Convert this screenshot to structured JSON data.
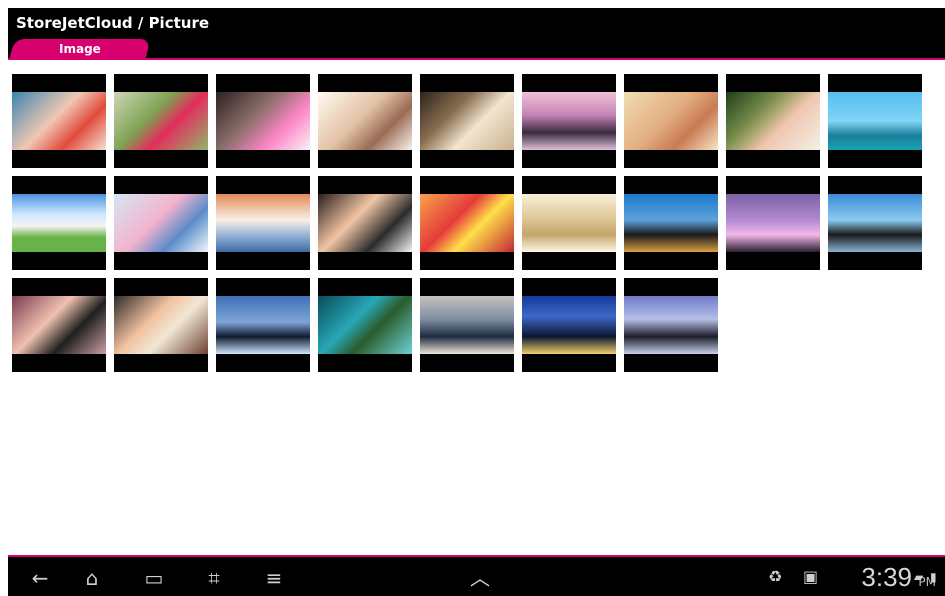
{
  "app": {
    "title": "StoreJetCloud / Picture",
    "tab_label": "Image",
    "accent_color": "#d8006f"
  },
  "gallery": {
    "rows": [
      {
        "items": [
          {
            "name": "kid-face-paint-thumbnail"
          },
          {
            "name": "pink-flower-thumbnail"
          },
          {
            "name": "couple-kiss-thumbnail"
          },
          {
            "name": "family-portrait-thumbnail"
          },
          {
            "name": "wedding-cake-thumbnail"
          },
          {
            "name": "venice-gondolas-thumbnail"
          },
          {
            "name": "mother-baby-thumbnail"
          },
          {
            "name": "grandpa-child-thumbnail"
          },
          {
            "name": "tropical-beach-thumbnail"
          }
        ]
      },
      {
        "items": [
          {
            "name": "dog-cat-thumbnail"
          },
          {
            "name": "kids-winter-thumbnail"
          },
          {
            "name": "coastal-town-thumbnail"
          },
          {
            "name": "wedding-couple-thumbnail"
          },
          {
            "name": "roses-bouquet-thumbnail"
          },
          {
            "name": "champagne-ornaments-thumbnail"
          },
          {
            "name": "cathedral-bridge-thumbnail"
          },
          {
            "name": "stonehenge-sunset-thumbnail"
          },
          {
            "name": "windmills-thumbnail"
          }
        ]
      },
      {
        "items": [
          {
            "name": "bride-groom-thumbnail"
          },
          {
            "name": "family-smiling-thumbnail"
          },
          {
            "name": "marina-night-thumbnail"
          },
          {
            "name": "islands-aerial-thumbnail"
          },
          {
            "name": "city-skyline-thumbnail"
          },
          {
            "name": "big-ben-night-thumbnail"
          },
          {
            "name": "tower-bridge-night-thumbnail"
          }
        ]
      }
    ]
  },
  "system_bar": {
    "time": "3:39",
    "ampm": "PM",
    "icons": [
      "back-icon",
      "home-icon",
      "recent-apps-icon",
      "screenshot-icon",
      "menu-icon",
      "up-chevron-icon",
      "recycle-icon",
      "briefcase-icon",
      "signal-icon",
      "battery-icon"
    ]
  }
}
